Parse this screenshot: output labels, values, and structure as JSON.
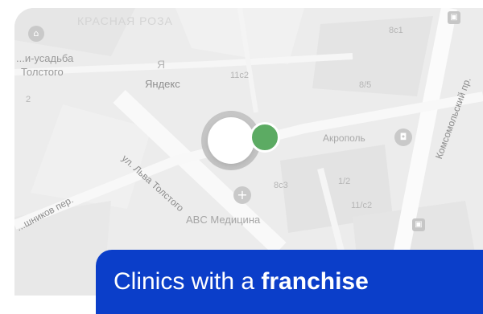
{
  "map": {
    "district_label": "КРАСНАЯ РОЗА",
    "museum_label_line1": "...и-усадьба",
    "museum_label_line2": "Толстого",
    "yandex_label": "Яндекс",
    "yandex_glyph": "Я",
    "street_tolstogo": "ул. Льва Толстого",
    "street_komsomolsky": "Комсомольский пр.",
    "street_pereulok": "...шников пер.",
    "akropol_label": "Акрополь",
    "clinic_label": "ABC Медицина",
    "house_numbers": [
      "8с1",
      "11с2",
      "8/5",
      "2",
      "8с3",
      "1/2",
      "11/с2"
    ],
    "clinic_glyph": "+",
    "akropol_glyph": "◘",
    "museum_glyph": "⌂",
    "building_glyph_1": "▣",
    "building_glyph_2": "▣"
  },
  "banner": {
    "text_regular": "Clinics with a ",
    "text_bold": "franchise"
  },
  "colors": {
    "banner_bg": "#0b3ec9",
    "pin_green": "#5cab63",
    "map_bg": "#ececec"
  }
}
